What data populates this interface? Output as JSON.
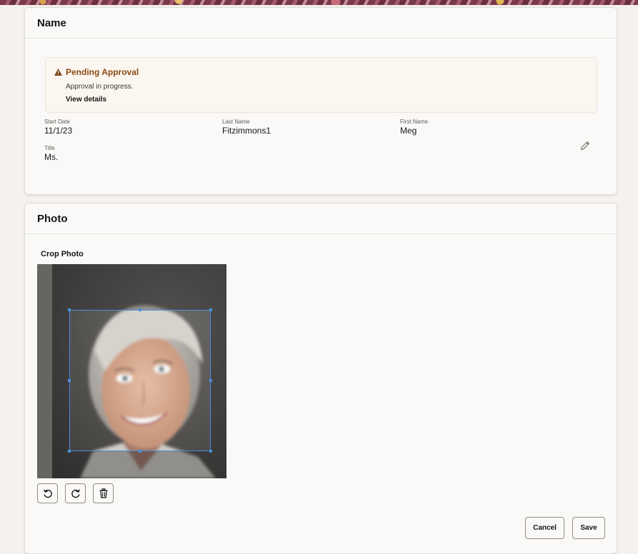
{
  "name_section": {
    "title": "Name",
    "alert": {
      "title": "Pending Approval",
      "message": "Approval in progress.",
      "link": "View details",
      "icon": "warning-icon",
      "color": "#8a4a12"
    },
    "fields": {
      "start_date": {
        "label": "Start Date",
        "value": "11/1/23"
      },
      "last_name": {
        "label": "Last Name",
        "value": "Fitzimmons1"
      },
      "first_name": {
        "label": "First Name",
        "value": "Meg"
      },
      "title": {
        "label": "Title",
        "value": "Ms."
      }
    },
    "edit_icon": "pencil-icon"
  },
  "photo_section": {
    "title": "Photo",
    "crop_label": "Crop Photo",
    "tools": [
      {
        "icon": "rotate-left-icon"
      },
      {
        "icon": "rotate-right-icon"
      },
      {
        "icon": "trash-icon"
      }
    ],
    "cancel_label": "Cancel",
    "save_label": "Save"
  },
  "colors": {
    "page_bg": "#f4f1ee",
    "card_bg": "#faf9f8",
    "alert_bg": "#fcf6f0",
    "crop_border": "#4a8fd8"
  }
}
